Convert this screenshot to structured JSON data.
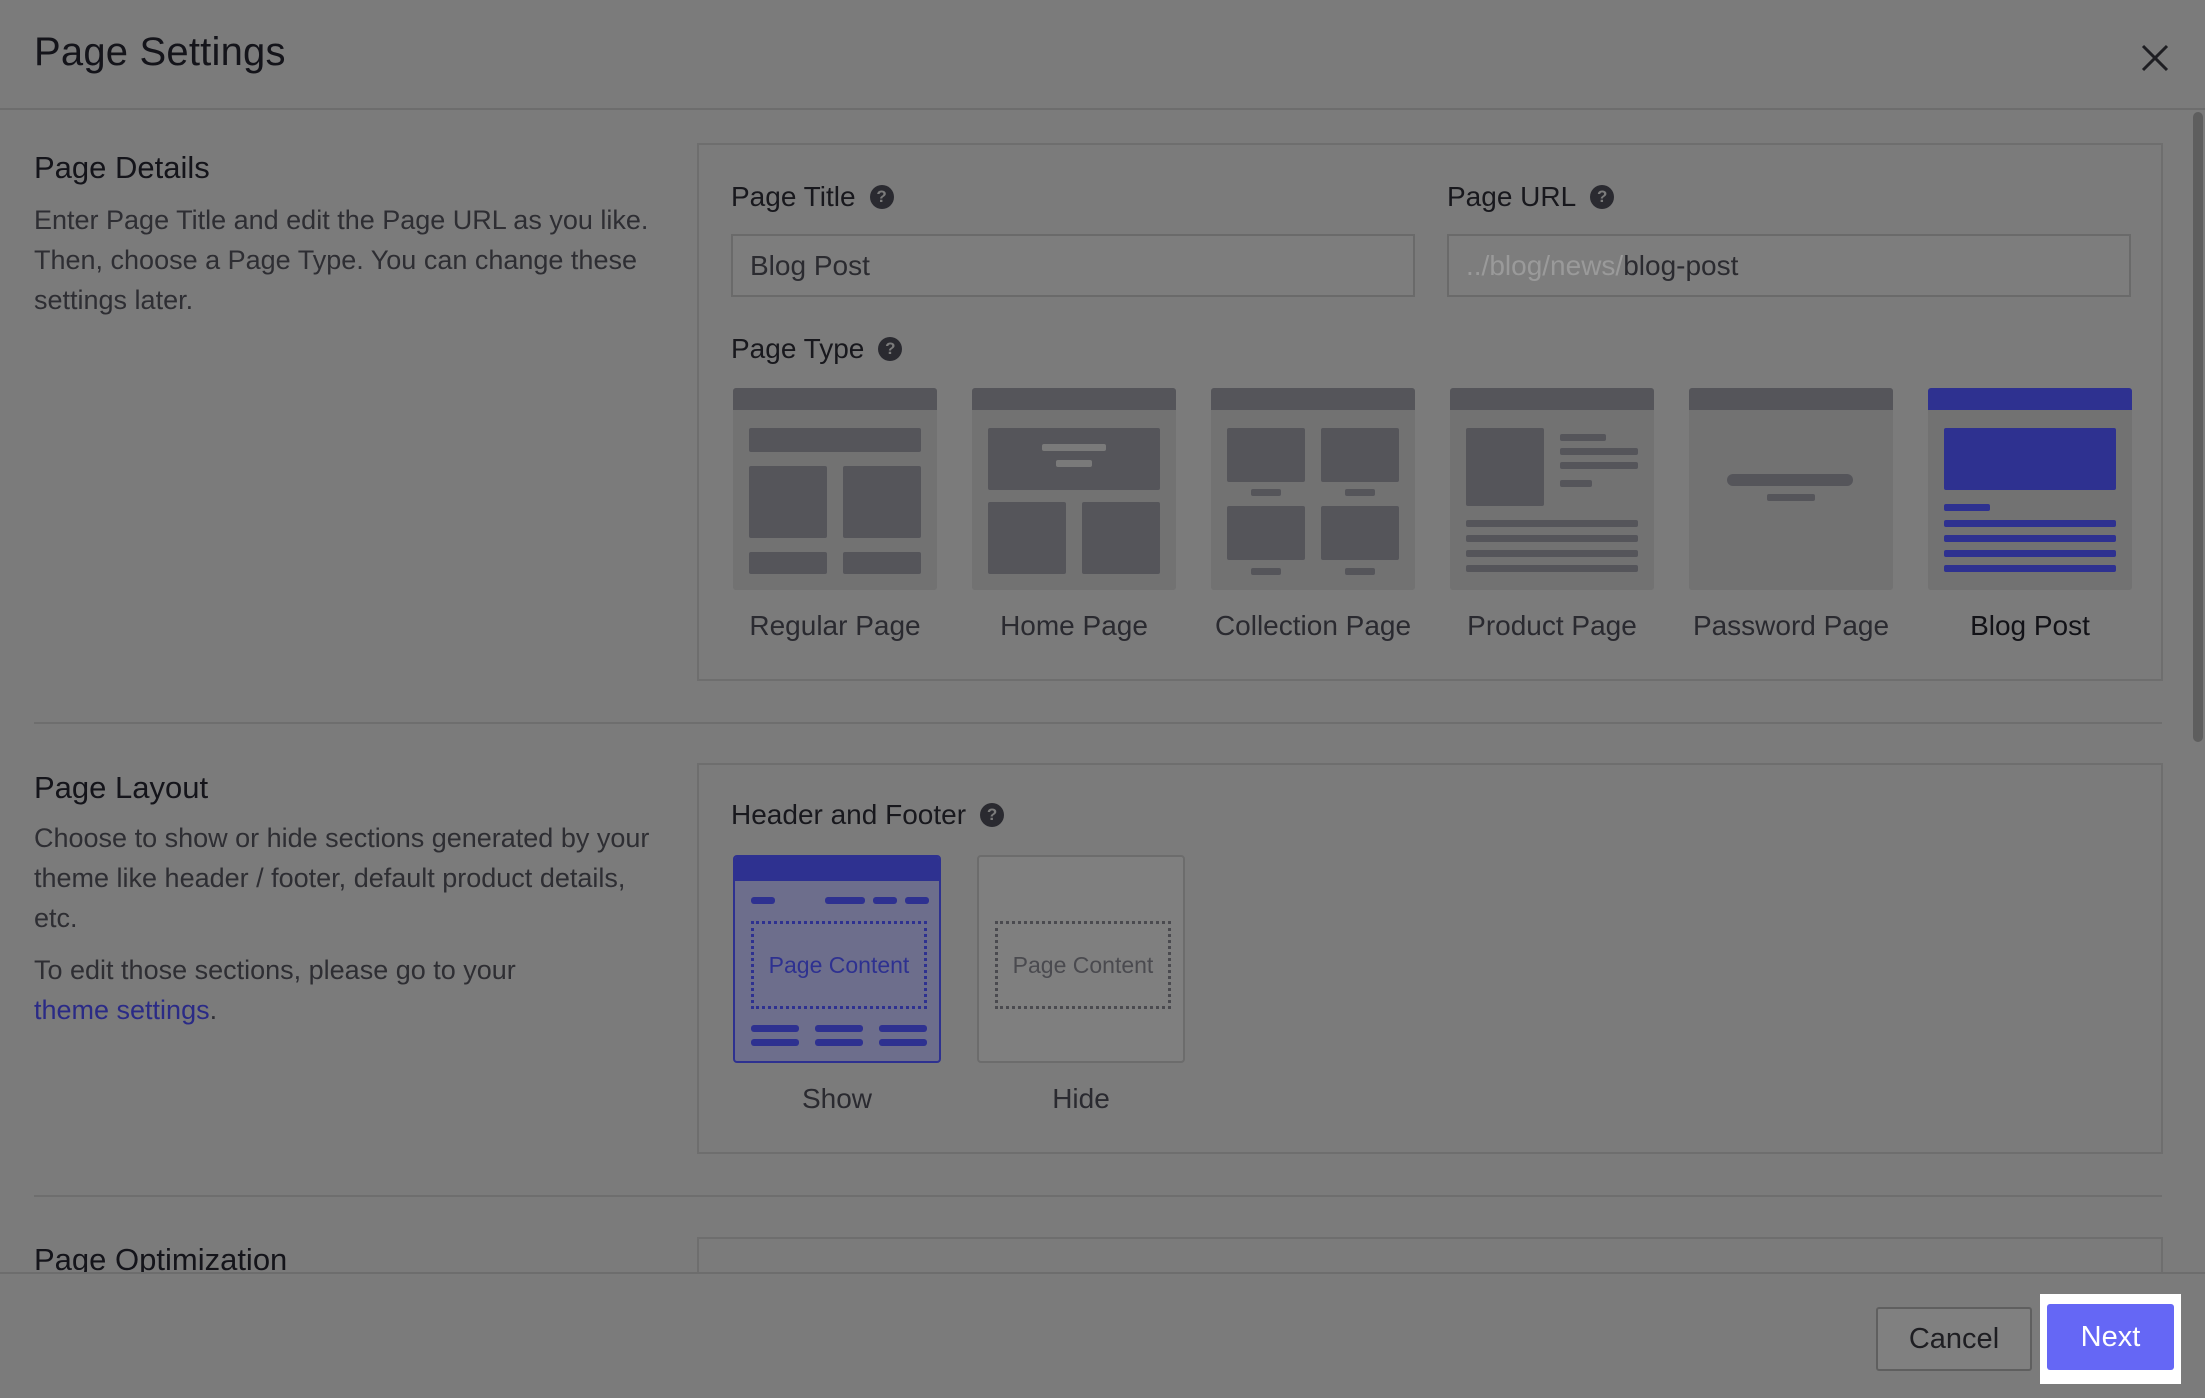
{
  "header": {
    "title": "Page Settings",
    "close_icon": "close-icon"
  },
  "page_details": {
    "heading": "Page Details",
    "description": "Enter Page Title and edit the Page URL as you like. Then, choose a Page Type. You can change these settings later.",
    "page_title_label": "Page Title",
    "page_title_value": "Blog Post",
    "page_url_label": "Page URL",
    "page_url_prefix": "../blog/news/",
    "page_url_slug": "blog-post",
    "page_type_label": "Page Type",
    "page_types": [
      {
        "label": "Regular Page",
        "selected": false
      },
      {
        "label": "Home Page",
        "selected": false
      },
      {
        "label": "Collection Page",
        "selected": false
      },
      {
        "label": "Product Page",
        "selected": false
      },
      {
        "label": "Password Page",
        "selected": false
      },
      {
        "label": "Blog Post",
        "selected": true
      }
    ]
  },
  "page_layout": {
    "heading": "Page Layout",
    "description": "Choose to show or hide sections generated by your theme like header / footer, default product details, etc.",
    "edit_note": "To edit those sections, please go to your",
    "link_text": "theme settings",
    "link_suffix": ".",
    "header_footer_label": "Header and Footer",
    "options": [
      {
        "label": "Show",
        "content": "Page Content",
        "selected": true
      },
      {
        "label": "Hide",
        "content": "Page Content",
        "selected": false
      }
    ]
  },
  "page_optimization": {
    "heading": "Page Optimization"
  },
  "footer": {
    "cancel_label": "Cancel",
    "next_label": "Next"
  },
  "colors": {
    "accent": "#6567f5",
    "selected_dark": "#2e3190",
    "overlay": "#7b7b7b"
  }
}
